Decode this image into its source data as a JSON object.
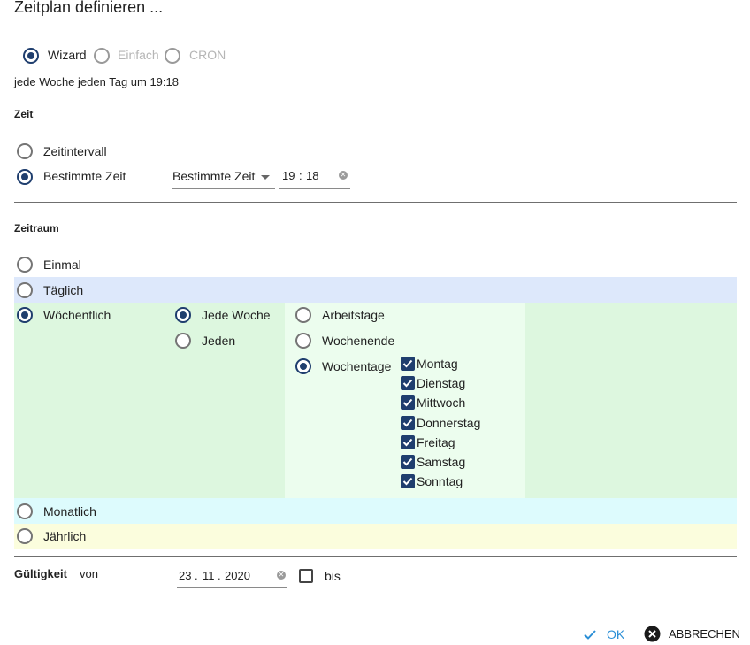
{
  "dialog": {
    "title": "Zeitplan definieren ..."
  },
  "mode": {
    "options": [
      {
        "label": "Wizard",
        "selected": true,
        "enabled": true
      },
      {
        "label": "Einfach",
        "selected": false,
        "enabled": false
      },
      {
        "label": "CRON",
        "selected": false,
        "enabled": false
      }
    ]
  },
  "summary": "jede Woche jeden Tag um 19:18",
  "zeit": {
    "heading": "Zeit",
    "interval_label": "Zeitintervall",
    "specific_label": "Bestimmte Zeit",
    "dropdown_value": "Bestimmte Zeit",
    "time_hour": "19",
    "time_sep": ":",
    "time_minute": "18"
  },
  "zeitraum": {
    "heading": "Zeitraum",
    "einmal": "Einmal",
    "taeglich": "Täglich",
    "woechentlich": "Wöchentlich",
    "jede_woche": "Jede Woche",
    "jeden": "Jeden",
    "arbeitstage": "Arbeitstage",
    "wochenende": "Wochenende",
    "wochentage": "Wochentage",
    "days": [
      "Montag",
      "Dienstag",
      "Mittwoch",
      "Donnerstag",
      "Freitag",
      "Samstag",
      "Sonntag"
    ],
    "monatlich": "Monatlich",
    "jaehrlich": "Jährlich"
  },
  "gueltigkeit": {
    "heading": "Gültigkeit",
    "von_label": "von",
    "date_day": "23",
    "date_sep": ".",
    "date_month": "11",
    "date_year": "2020",
    "bis_label": "bis"
  },
  "actions": {
    "ok": "OK",
    "cancel": "ABBRECHEN"
  },
  "colors": {
    "accent": "#1f3e6e",
    "ok_blue": "#2b8fd6",
    "band_daily": "#dde8fb",
    "band_weekly": "#ddf7df",
    "band_weekly_inner": "#ecfdee",
    "band_monthly": "#ddfbfd",
    "band_yearly": "#fbfddd"
  }
}
